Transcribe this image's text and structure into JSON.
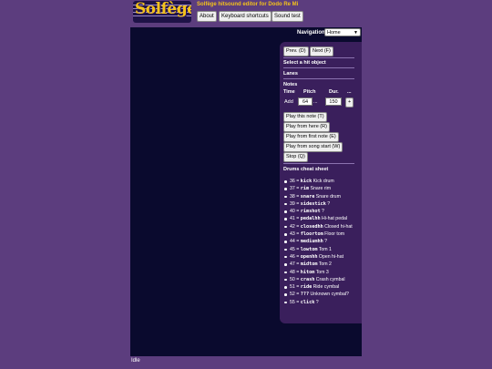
{
  "header": {
    "logo_text": "Solfège",
    "app_title": "Solfège hitsound editor for Dodo Re Mi",
    "buttons": [
      "About",
      "Keyboard shortcuts",
      "Sound test"
    ]
  },
  "navigation": {
    "label": "Navigation",
    "selected": "Home"
  },
  "panel": {
    "prev_label": "Prev. (D)",
    "next_label": "Next (F)",
    "select_heading": "Select a hit object",
    "lanes_heading": "Lanes",
    "notes_heading": "Notes",
    "columns": {
      "time": "Time",
      "pitch": "Pitch",
      "dur": "Dur.",
      "more": "..."
    },
    "add_label": "Add",
    "pitch_value": "64",
    "dots": "...",
    "dur_value": "150",
    "plus_label": "+",
    "play_buttons": [
      "Play this note (T)",
      "Play from here (R)",
      "Play from first note (E)",
      "Play from song start (W)",
      "Stop (Q)"
    ],
    "cheat_heading": "Drums cheat sheet",
    "drums": [
      {
        "num": "36",
        "code": "kick",
        "desc": "Kick drum"
      },
      {
        "num": "37",
        "code": "rim",
        "desc": "Snare rim"
      },
      {
        "num": "38",
        "code": "snare",
        "desc": "Snare drum"
      },
      {
        "num": "39",
        "code": "sidestick",
        "desc": "?"
      },
      {
        "num": "40",
        "code": "rimshot",
        "desc": "?"
      },
      {
        "num": "41",
        "code": "pedalhh",
        "desc": "Hi-hat pedal"
      },
      {
        "num": "42",
        "code": "closedhh",
        "desc": "Closed hi-hat"
      },
      {
        "num": "43",
        "code": "floortom",
        "desc": "Floor tom"
      },
      {
        "num": "44",
        "code": "mediumhh",
        "desc": "?"
      },
      {
        "num": "45",
        "code": "lowtom",
        "desc": "Tom 1"
      },
      {
        "num": "46",
        "code": "openhh",
        "desc": "Open hi-hat"
      },
      {
        "num": "47",
        "code": "midtom",
        "desc": "Tom 2"
      },
      {
        "num": "48",
        "code": "hitom",
        "desc": "Tom 3"
      },
      {
        "num": "50",
        "code": "crash",
        "desc": "Crash cymbal"
      },
      {
        "num": "51",
        "code": "ride",
        "desc": "Ride cymbal"
      },
      {
        "num": "52",
        "code": "???",
        "desc": "Unknown cymbal?"
      },
      {
        "num": "55",
        "code": "click",
        "desc": "?"
      }
    ]
  },
  "status": "Idle",
  "colors": {
    "page_bg": "#5c3d7e",
    "canvas_bg": "#0a0a2e",
    "panel_bg": "#3a1f5c",
    "accent_gold": "#f4c21b"
  }
}
